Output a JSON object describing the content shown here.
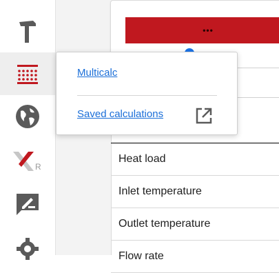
{
  "sidebar": {
    "items": [
      {
        "id": "tools",
        "icon": "hammer-icon",
        "active": false
      },
      {
        "id": "calculators",
        "icon": "calculator-grid-icon",
        "active": true
      },
      {
        "id": "globe",
        "icon": "globe-icon",
        "active": false
      },
      {
        "id": "xr",
        "icon": "xr-logo-icon",
        "active": false
      },
      {
        "id": "feedback",
        "icon": "edit-message-icon",
        "active": false
      },
      {
        "id": "settings",
        "icon": "gear-icon",
        "active": false
      }
    ]
  },
  "main": {
    "button_label": "•••",
    "table_rows": [
      "Heat load",
      "Inlet temperature",
      "Outlet temperature",
      "Flow rate"
    ]
  },
  "popover": {
    "multicalc_label": "Multicalc",
    "saved_label": "Saved calculations",
    "external_icon": "open-in-new-icon"
  },
  "colors": {
    "accent_red": "#c0181f",
    "link_blue": "#1a6ed8",
    "icon_gray": "#5a5a5a"
  }
}
